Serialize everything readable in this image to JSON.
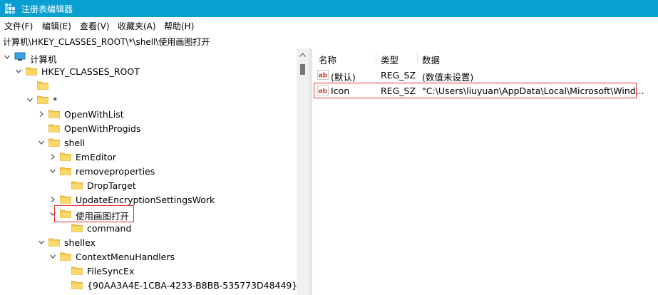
{
  "window": {
    "title": "注册表编辑器"
  },
  "menu": [
    "文件(F)",
    "编辑(E)",
    "查看(V)",
    "收藏夹(A)",
    "帮助(H)"
  ],
  "address": "计算机\\HKEY_CLASSES_ROOT\\*\\shell\\使用画图打开",
  "tree": [
    {
      "label": "计算机",
      "chev": "down",
      "icon": "computer"
    },
    {
      "label": "HKEY_CLASSES_ROOT",
      "chev": "down",
      "icon": "folder"
    },
    {
      "label": "",
      "chev": "",
      "icon": "folder"
    },
    {
      "label": "*",
      "chev": "down",
      "icon": "folder"
    },
    {
      "label": "OpenWithList",
      "chev": "right",
      "icon": "folder"
    },
    {
      "label": "OpenWithProgids",
      "chev": "",
      "icon": "folder"
    },
    {
      "label": "shell",
      "chev": "down",
      "icon": "folder"
    },
    {
      "label": "EmEditor",
      "chev": "right",
      "icon": "folder"
    },
    {
      "label": "removeproperties",
      "chev": "down",
      "icon": "folder"
    },
    {
      "label": "DropTarget",
      "chev": "",
      "icon": "folder"
    },
    {
      "label": "UpdateEncryptionSettingsWork",
      "chev": "right",
      "icon": "folder"
    },
    {
      "label": "使用画图打开",
      "chev": "down",
      "icon": "folder-open",
      "selected": true
    },
    {
      "label": "command",
      "chev": "",
      "icon": "folder"
    },
    {
      "label": "shellex",
      "chev": "down",
      "icon": "folder"
    },
    {
      "label": "ContextMenuHandlers",
      "chev": "down",
      "icon": "folder"
    },
    {
      "label": "FileSyncEx",
      "chev": "",
      "icon": "folder"
    },
    {
      "label": "{90AA3A4E-1CBA-4233-B8BB-535773D48449}",
      "chev": "",
      "icon": "folder"
    }
  ],
  "list": {
    "columns": [
      "名称",
      "类型",
      "数据"
    ],
    "rows": [
      {
        "name": "(默认)",
        "type": "REG_SZ",
        "data": "(数值未设置)",
        "icon": "ab-icon"
      },
      {
        "name": "Icon",
        "type": "REG_SZ",
        "data": "\"C:\\Users\\liuyuan\\AppData\\Local\\Microsoft\\Wind...",
        "icon": "ab-icon",
        "highlighted": true
      }
    ]
  },
  "colors": {
    "titlebar": "#0a9fd1",
    "highlight_border": "#e03030",
    "folder": "#f7c948"
  }
}
